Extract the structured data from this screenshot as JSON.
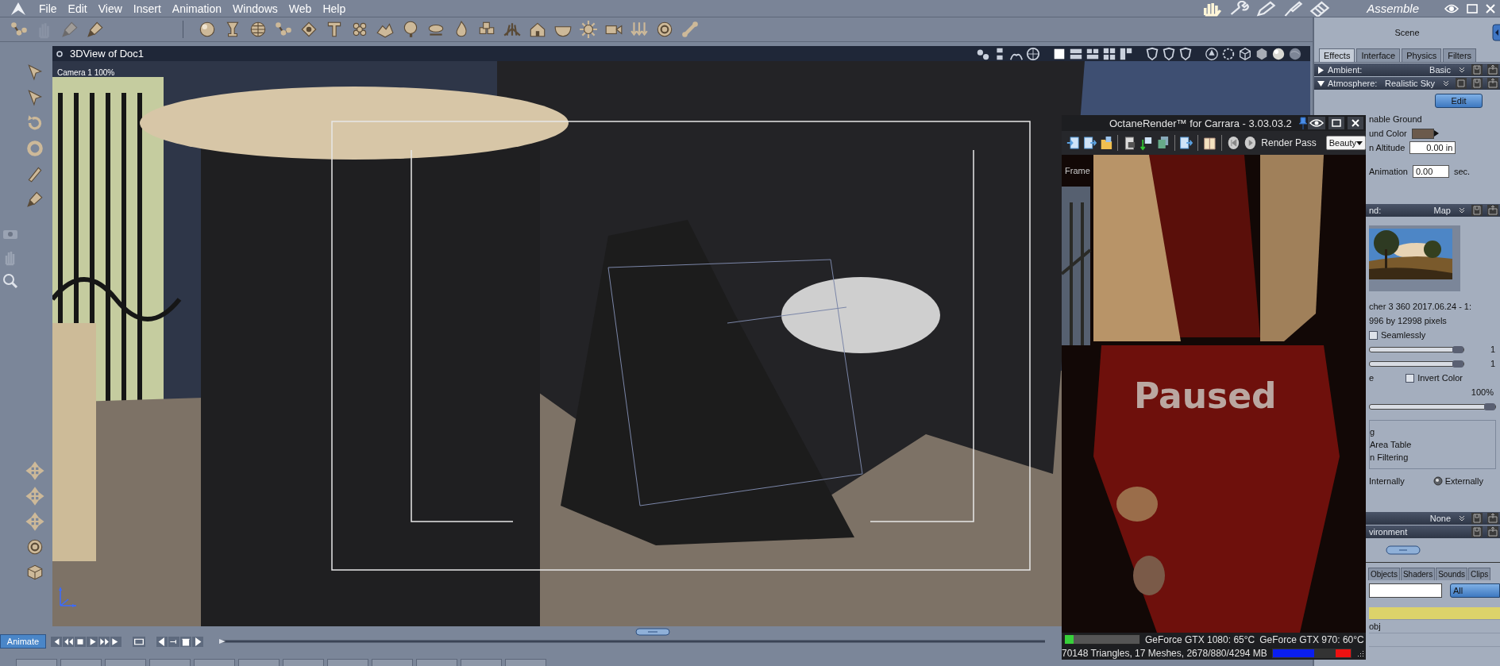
{
  "menu_bar": {
    "items": [
      "File",
      "Edit",
      "View",
      "Insert",
      "Animation",
      "Windows",
      "Web",
      "Help"
    ],
    "room": "Assemble"
  },
  "view_window": {
    "title": "3DView of Doc1",
    "camera_label": "Camera 1 100%"
  },
  "scene_panel": {
    "title": "Scene",
    "tabs": [
      {
        "label": "Effects",
        "selected": true
      },
      {
        "label": "Interface",
        "selected": false
      },
      {
        "label": "Physics",
        "selected": false
      },
      {
        "label": "Filters",
        "selected": false
      }
    ],
    "ambient": {
      "label": "Ambient:",
      "value": "Basic",
      "expanded": false
    },
    "atmosphere": {
      "label": "Atmosphere:",
      "value": "Realistic Sky",
      "expanded": true
    },
    "edit_button": "Edit",
    "enable_ground_label": "nable Ground",
    "ground_color_label": "und Color",
    "altitude": {
      "label": "n Altitude",
      "value": "0.00 in"
    },
    "animation": {
      "label": "Animation",
      "value": "0.00",
      "unit": "sec."
    },
    "background_header": {
      "label": "nd:",
      "value": "Map"
    },
    "map_name": "cher 3 360 2017.06.24 - 1:",
    "map_size": "996 by 12998 pixels",
    "seamlessly": {
      "label": "Seamlessly",
      "checked": false
    },
    "sliders": [
      {
        "level": 1,
        "reading": "1"
      },
      {
        "level": 1,
        "reading": "1"
      }
    ],
    "e_label": "e",
    "invert_color": {
      "label": "Invert Color",
      "checked": false
    },
    "intensity": {
      "reading": "100%",
      "level": 1
    },
    "filtering_options": [
      "g",
      "Area Table",
      "n Filtering"
    ],
    "internally_label": "Internally",
    "externally": {
      "label": "Externally",
      "selected": true
    },
    "none_header": {
      "value": "None"
    },
    "environment_header": {
      "label": "vironment"
    },
    "browser_tabs": [
      {
        "label": "Objects",
        "selected": false
      },
      {
        "label": "Shaders",
        "selected": false
      },
      {
        "label": "Sounds",
        "selected": false
      },
      {
        "label": "Clips",
        "selected": false
      }
    ],
    "filter_dropdown": "All",
    "browser_rows": [
      {
        "selected": true
      },
      {
        "label": "obj",
        "selected": false
      }
    ]
  },
  "octane_window": {
    "title": "OctaneRender™ for Carrara - 3.03.03.2",
    "render_pass_label": "Render Pass",
    "render_pass_value": "Beauty",
    "frame_label": "Frame",
    "overlay": "Paused",
    "progress": {
      "level": 0.12
    },
    "gpu_1": "GeForce GTX 1080: 65°C",
    "gpu_2": "GeForce GTX 970: 60°C",
    "stats": "70148 Triangles, 17 Meshes, 2678/880/4294 MB"
  },
  "timeline": {
    "animate_button": "Animate"
  }
}
